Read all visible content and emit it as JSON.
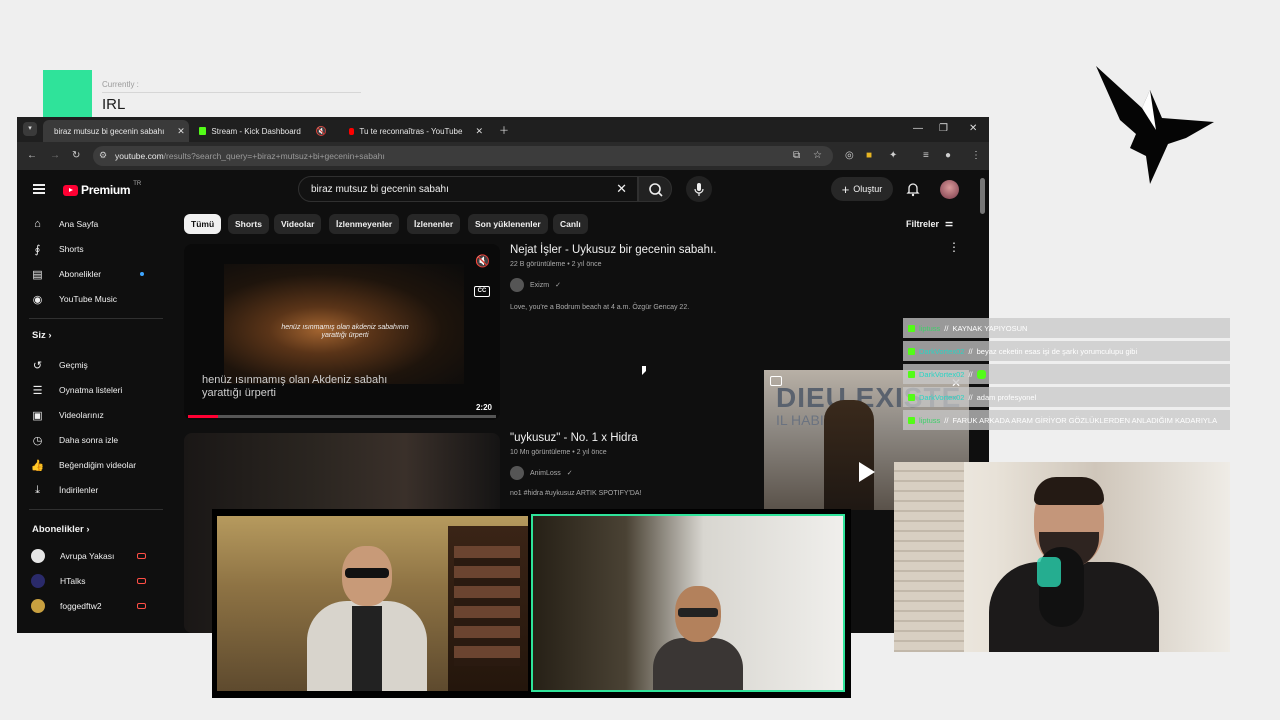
{
  "overlay": {
    "currently_label": "Currently :",
    "category": "IRL",
    "accent_color": "#2fe39a"
  },
  "browser": {
    "tabs": [
      {
        "label": "biraz mutsuz bi gecenin sabahı",
        "icon": "youtube-icon",
        "active": true
      },
      {
        "label": "Stream - Kick Dashboard",
        "icon": "kick-icon",
        "active": false
      },
      {
        "label": "Tu te reconnaîtras - YouTube",
        "icon": "youtube-icon",
        "active": false
      }
    ],
    "url_host": "youtube.com",
    "url_rest": "/results?search_query=+biraz+mutsuz+bi+gecenin+sabahı"
  },
  "youtube": {
    "logo_text": "Premium",
    "logo_region": "TR",
    "search_query": "biraz mutsuz bi gecenin sabahı",
    "create_label": "Oluştur",
    "sidebar": {
      "main": [
        {
          "label": "Ana Sayfa",
          "icon": "home-icon"
        },
        {
          "label": "Shorts",
          "icon": "shorts-icon"
        },
        {
          "label": "Abonelikler",
          "icon": "subscriptions-icon"
        },
        {
          "label": "YouTube Music",
          "icon": "music-icon"
        }
      ],
      "you_heading": "Siz",
      "you": [
        {
          "label": "Geçmiş",
          "icon": "history-icon"
        },
        {
          "label": "Oynatma listeleri",
          "icon": "playlist-icon"
        },
        {
          "label": "Videolarınız",
          "icon": "your-videos-icon"
        },
        {
          "label": "Daha sonra izle",
          "icon": "watch-later-icon"
        },
        {
          "label": "Beğendiğim videolar",
          "icon": "like-icon"
        },
        {
          "label": "İndirilenler",
          "icon": "download-icon"
        }
      ],
      "subs_heading": "Abonelikler",
      "subs": [
        {
          "label": "Avrupa Yakası",
          "color": "#e6e6e6"
        },
        {
          "label": "HTalks",
          "color": "#2a2a6a"
        },
        {
          "label": "foggedftw2",
          "color": "#c8a040"
        }
      ]
    },
    "chips": [
      "Tümü",
      "Shorts",
      "Videolar",
      "İzlenmeyenler",
      "İzlenenler",
      "Son yüklenenler",
      "Canlı"
    ],
    "filters_label": "Filtreler",
    "results": [
      {
        "title": "Nejat İşler - Uykusuz bir gecenin sabahı.",
        "meta": "22 B görüntüleme • 2 yıl önce",
        "channel": "Exizm",
        "description": "Love, you're a Bodrum beach at 4 a.m. Özgür Gencay 22.",
        "duration": "2:20",
        "caption_small": "henüz ısınmamış olan akdeniz sabahının yarattığı ürperti",
        "caption_large": "henüz ısınmamış olan Akdeniz sabahı yarattığı ürperti"
      },
      {
        "title": "\"uykusuz\" - No. 1 x Hidra",
        "meta": "10 Mn görüntüleme • 2 yıl önce",
        "channel": "AnimLoss",
        "description": "no1 #hidra #uykusuz ARTIK SPOTIFY'DA!"
      }
    ],
    "miniplayer": {
      "title": "DIEU EXISTE",
      "subtitle": "IL HABITE"
    }
  },
  "chat": [
    {
      "user": "liptuss",
      "message": "KAYNAK YAPIYOSUN"
    },
    {
      "user": "DarkVortex02",
      "message": "beyaz ceketin esas işi de şarkı yorumculupu gibi"
    },
    {
      "user": "DarkVortex02",
      "message": ""
    },
    {
      "user": "DarkVortex02",
      "message": "adam profesyonel"
    },
    {
      "user": "liptuss",
      "message": "FARUK ARKADA ARAM GİRİYOR GÖZLÜKLERDEN ANLADIĞIM KADARIYLA"
    }
  ]
}
